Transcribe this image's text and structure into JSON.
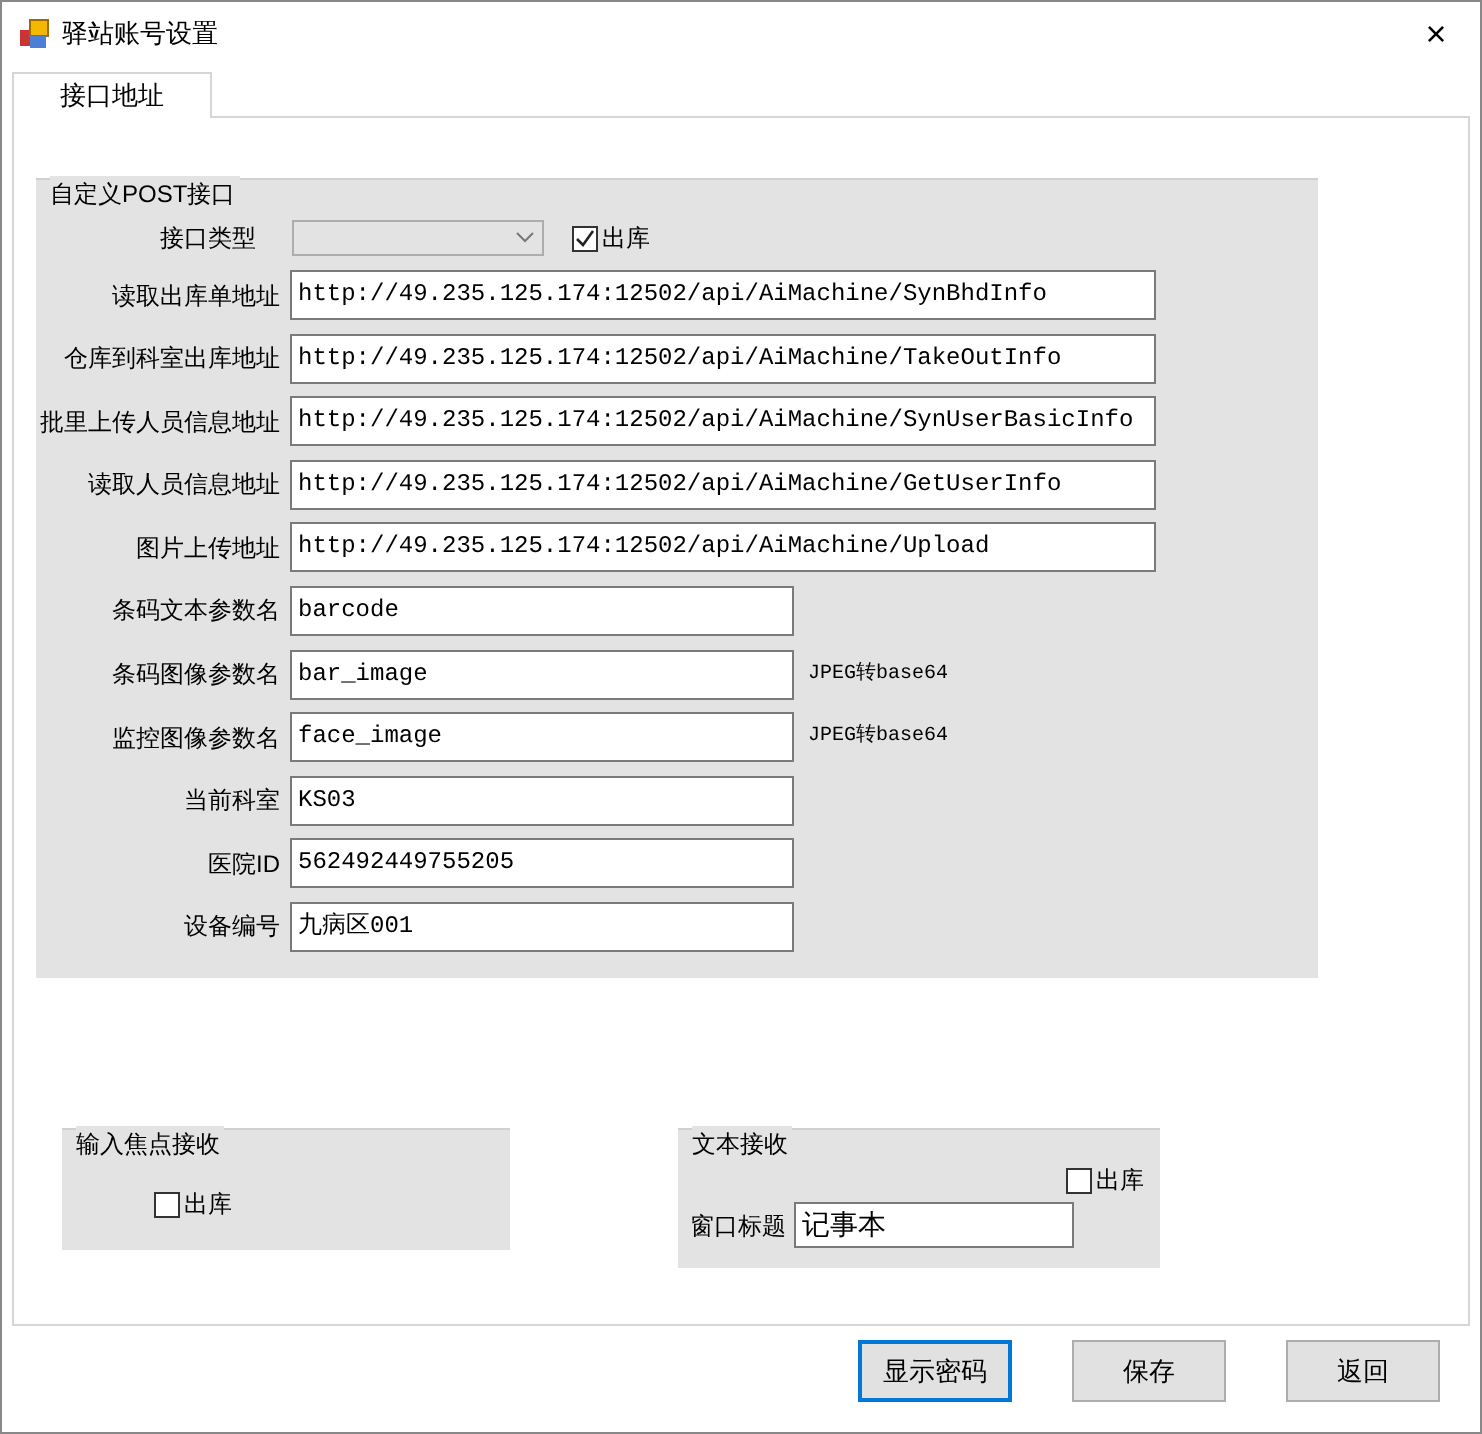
{
  "window": {
    "title": "驿站账号设置",
    "close": "×"
  },
  "tabs": [
    {
      "label": "接口地址",
      "selected": true
    }
  ],
  "post_group": {
    "title": "自定义POST接口",
    "interface_type": {
      "label": "接口类型",
      "disabled": true
    },
    "outbound": {
      "label": "出库",
      "checked": true
    },
    "fields": [
      {
        "label": "读取出库单地址",
        "value": "http://49.235.125.174:12502/api/AiMachine/SynBhdInfo",
        "kind": "long"
      },
      {
        "label": "仓库到科室出库地址",
        "value": "http://49.235.125.174:12502/api/AiMachine/TakeOutInfo",
        "kind": "long"
      },
      {
        "label": "批里上传人员信息地址",
        "value": "http://49.235.125.174:12502/api/AiMachine/SynUserBasicInfo",
        "kind": "long"
      },
      {
        "label": "读取人员信息地址",
        "value": "http://49.235.125.174:12502/api/AiMachine/GetUserInfo",
        "kind": "long"
      },
      {
        "label": "图片上传地址",
        "value": "http://49.235.125.174:12502/api/AiMachine/Upload",
        "kind": "long"
      },
      {
        "label": "条码文本参数名",
        "value": "barcode",
        "kind": "short"
      },
      {
        "label": "条码图像参数名",
        "value": "bar_image",
        "kind": "short",
        "note": "JPEG转base64"
      },
      {
        "label": "监控图像参数名",
        "value": "face_image",
        "kind": "short",
        "note": "JPEG转base64"
      },
      {
        "label": "当前科室",
        "value": "KS03",
        "kind": "short"
      },
      {
        "label": "医院ID",
        "value": "562492449755205",
        "kind": "short"
      },
      {
        "label": "设备编号",
        "value": "九病区001",
        "kind": "short"
      }
    ]
  },
  "focus_group": {
    "title": "输入焦点接收",
    "outbound": {
      "label": "出库",
      "checked": false
    }
  },
  "text_group": {
    "title": "文本接收",
    "outbound": {
      "label": "出库",
      "checked": false
    },
    "window_title": {
      "label": "窗口标题",
      "value": "记事本"
    }
  },
  "buttons": [
    {
      "label": "显示密码",
      "focused": true
    },
    {
      "label": "保存",
      "focused": false
    },
    {
      "label": "返回",
      "focused": false
    }
  ]
}
